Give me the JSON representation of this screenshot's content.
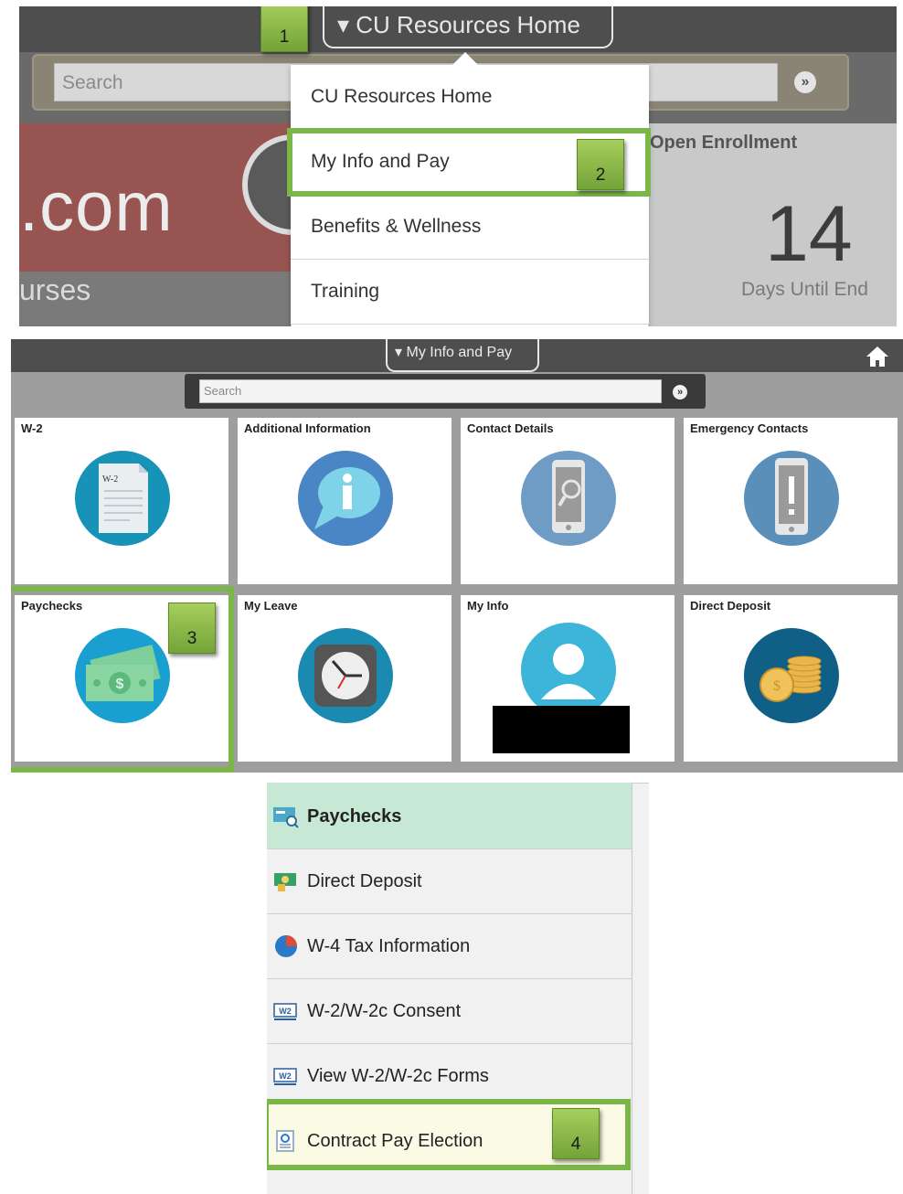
{
  "panel1": {
    "title": "CU Resources Home",
    "search_placeholder": "Search",
    "banner_text": ".com",
    "strip_text": "urses",
    "enrollment": {
      "title": "Open Enrollment",
      "count": "14",
      "subtitle": "Days Until End"
    },
    "menu_items": [
      "CU Resources Home",
      "My Info and Pay",
      "Benefits & Wellness",
      "Training"
    ],
    "badges": [
      "1",
      "2"
    ]
  },
  "panel2": {
    "title": "My Info and Pay",
    "search_placeholder": "Search",
    "tiles": [
      {
        "label": "W-2",
        "icon": "w2-document-icon",
        "color": "#1893b8",
        "doc_text": "W-2"
      },
      {
        "label": "Additional Information",
        "icon": "info-bubble-icon",
        "color": "#4a86c6"
      },
      {
        "label": "Contact Details",
        "icon": "phone-search-icon",
        "color": "#6f9cc4"
      },
      {
        "label": "Emergency Contacts",
        "icon": "phone-alert-icon",
        "color": "#5a8fba"
      },
      {
        "label": "Paychecks",
        "icon": "money-icon",
        "color": "#1aa0d0"
      },
      {
        "label": "My Leave",
        "icon": "clock-icon",
        "color": "#1b8ab0"
      },
      {
        "label": "My Info",
        "icon": "person-icon",
        "color": "#3db5d8"
      },
      {
        "label": "Direct Deposit",
        "icon": "coins-icon",
        "color": "#0f5f86"
      }
    ],
    "badge": "3"
  },
  "panel3": {
    "items": [
      {
        "label": "Paychecks",
        "icon": "paycheck-search-icon"
      },
      {
        "label": "Direct Deposit",
        "icon": "deposit-icon"
      },
      {
        "label": "W-4 Tax Information",
        "icon": "pie-chart-icon"
      },
      {
        "label": "W-2/W-2c Consent",
        "icon": "w2-form-icon",
        "icon_text": "W2"
      },
      {
        "label": "View W-2/W-2c Forms",
        "icon": "w2-form-icon",
        "icon_text": "W2"
      },
      {
        "label": "Contract Pay Election",
        "icon": "contract-icon"
      }
    ],
    "badge": "4"
  },
  "colors": {
    "highlight": "#7ab648",
    "badge": "#8fbf4a",
    "header_green": "#c8e8d6"
  }
}
